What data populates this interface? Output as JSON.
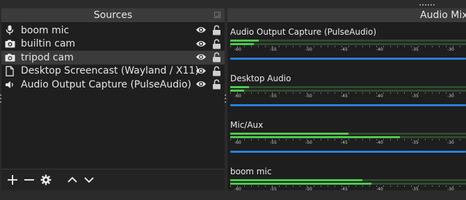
{
  "sources_dock": {
    "title": "Sources",
    "items": [
      {
        "label": "boom mic",
        "icon": "microphone-icon",
        "selected": false
      },
      {
        "label": "builtin cam",
        "icon": "camera-icon",
        "selected": false
      },
      {
        "label": "tripod cam",
        "icon": "camera-icon",
        "selected": true
      },
      {
        "label": "Desktop Screencast (Wayland / X11)",
        "icon": "document-icon",
        "selected": false
      },
      {
        "label": "Audio Output Capture (PulseAudio)",
        "icon": "speaker-icon",
        "selected": false
      }
    ],
    "toolbar": [
      "add-icon",
      "remove-icon",
      "gear-icon",
      "move-up-icon",
      "move-down-icon"
    ]
  },
  "audio_mixer": {
    "title": "Audio Mixer",
    "tick_labels": [
      "-60",
      "-55",
      "-50",
      "-45",
      "-40",
      "-35",
      "-30"
    ],
    "channels": [
      {
        "name": "Audio Output Capture (PulseAudio)",
        "levels": [
          0.12,
          0.1
        ]
      },
      {
        "name": "Desktop Audio",
        "levels": [
          0.08,
          0.06
        ]
      },
      {
        "name": "Mic/Aux",
        "levels": [
          0.5,
          0.72
        ]
      },
      {
        "name": "boom mic",
        "levels": [
          0.56,
          0.6
        ]
      }
    ]
  },
  "colors": {
    "accent": "#2a82da",
    "meter": "#4ec94e",
    "meter_bg": "#2f4a2f"
  }
}
